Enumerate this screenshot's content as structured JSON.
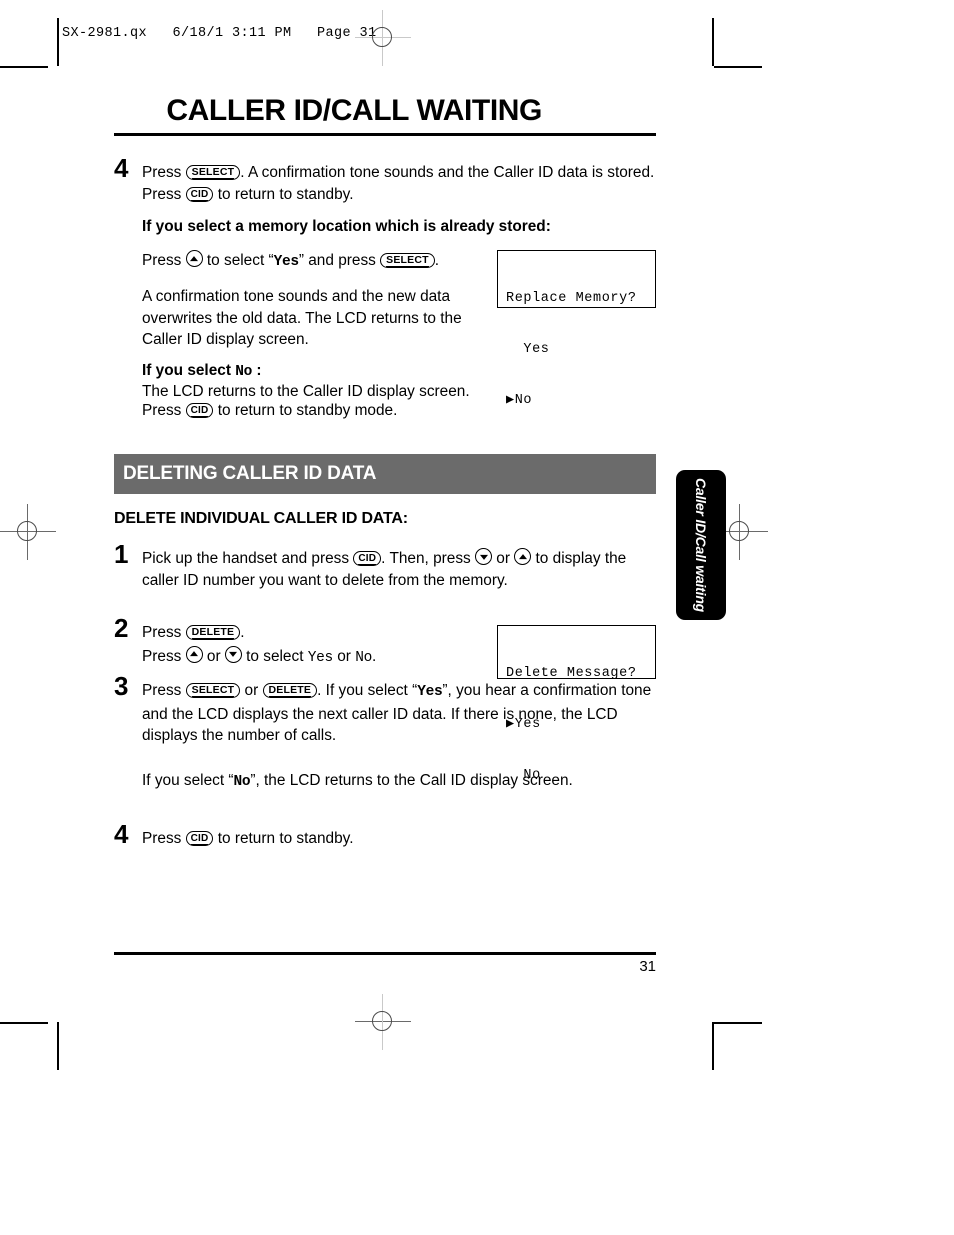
{
  "print_header": "SX-2981.qx   6/18/1 3:11 PM   Page 31",
  "document": {
    "title": "CALLER ID/CALL WAITING",
    "page_number": "31",
    "side_tab_label": "Caller ID/Call waiting"
  },
  "keys": {
    "select": "SELECT",
    "cid": "CID",
    "delete": "DELETE"
  },
  "section_a": {
    "step4": {
      "number": "4",
      "text_1": "Press ",
      "text_2": ". A confirmation tone sounds and the Caller ID data is stored. Press ",
      "text_3": " to return to standby."
    },
    "already_stored_heading": "If you select a memory location which is already stored:",
    "press_yes": {
      "text_1": "Press ",
      "text_2": " to select “",
      "yes": "Yes",
      "text_3": "” and press ",
      "text_4": "."
    },
    "confirmation_paragraph": "A confirmation tone sounds and the new data overwrites the old data. The LCD returns to the Caller ID display screen.",
    "if_no_heading_1": "If you select ",
    "if_no_heading_no": "No",
    "if_no_heading_2": " :",
    "if_no_body_line1": "The LCD returns to the Caller ID display screen.",
    "if_no_body_line2_a": "Press ",
    "if_no_body_line2_b": " to return to standby mode.",
    "lcd": {
      "line1": "Replace Memory?",
      "line2": "  Yes",
      "line3": "▶No"
    }
  },
  "section_b": {
    "banner": "DELETING CALLER ID DATA",
    "subhead": "DELETE INDIVIDUAL CALLER ID DATA:",
    "step1": {
      "number": "1",
      "text_1": "Pick up the handset and press ",
      "text_2": ". Then, press ",
      "text_3": " or ",
      "text_4": " to display the caller ID number you want to delete from the memory."
    },
    "step2": {
      "number": "2",
      "line1_a": "Press ",
      "line1_b": ".",
      "line2_a": "Press ",
      "line2_b": " or ",
      "line2_c": " to select ",
      "line2_yes": "Yes",
      "line2_d": " or ",
      "line2_no": "No",
      "line2_e": "."
    },
    "step3": {
      "number": "3",
      "text_1": "Press ",
      "text_2": " or ",
      "text_3": ".  If you select “",
      "yes": "Yes",
      "text_4": "”, you hear a confirmation tone and the LCD displays the next caller ID data. If there is none, the LCD displays the number of calls.",
      "para2_1": "If you select “",
      "para2_no": "No",
      "para2_2": "”, the LCD returns to the Call ID display screen."
    },
    "step4": {
      "number": "4",
      "text_1": "Press ",
      "text_2": " to return to standby."
    },
    "lcd": {
      "line1": "Delete Message?",
      "line2": "▶Yes",
      "line3": "  No"
    }
  },
  "colors": {
    "banner_grey": "#6b6b6b",
    "tab_black": "#000000"
  }
}
